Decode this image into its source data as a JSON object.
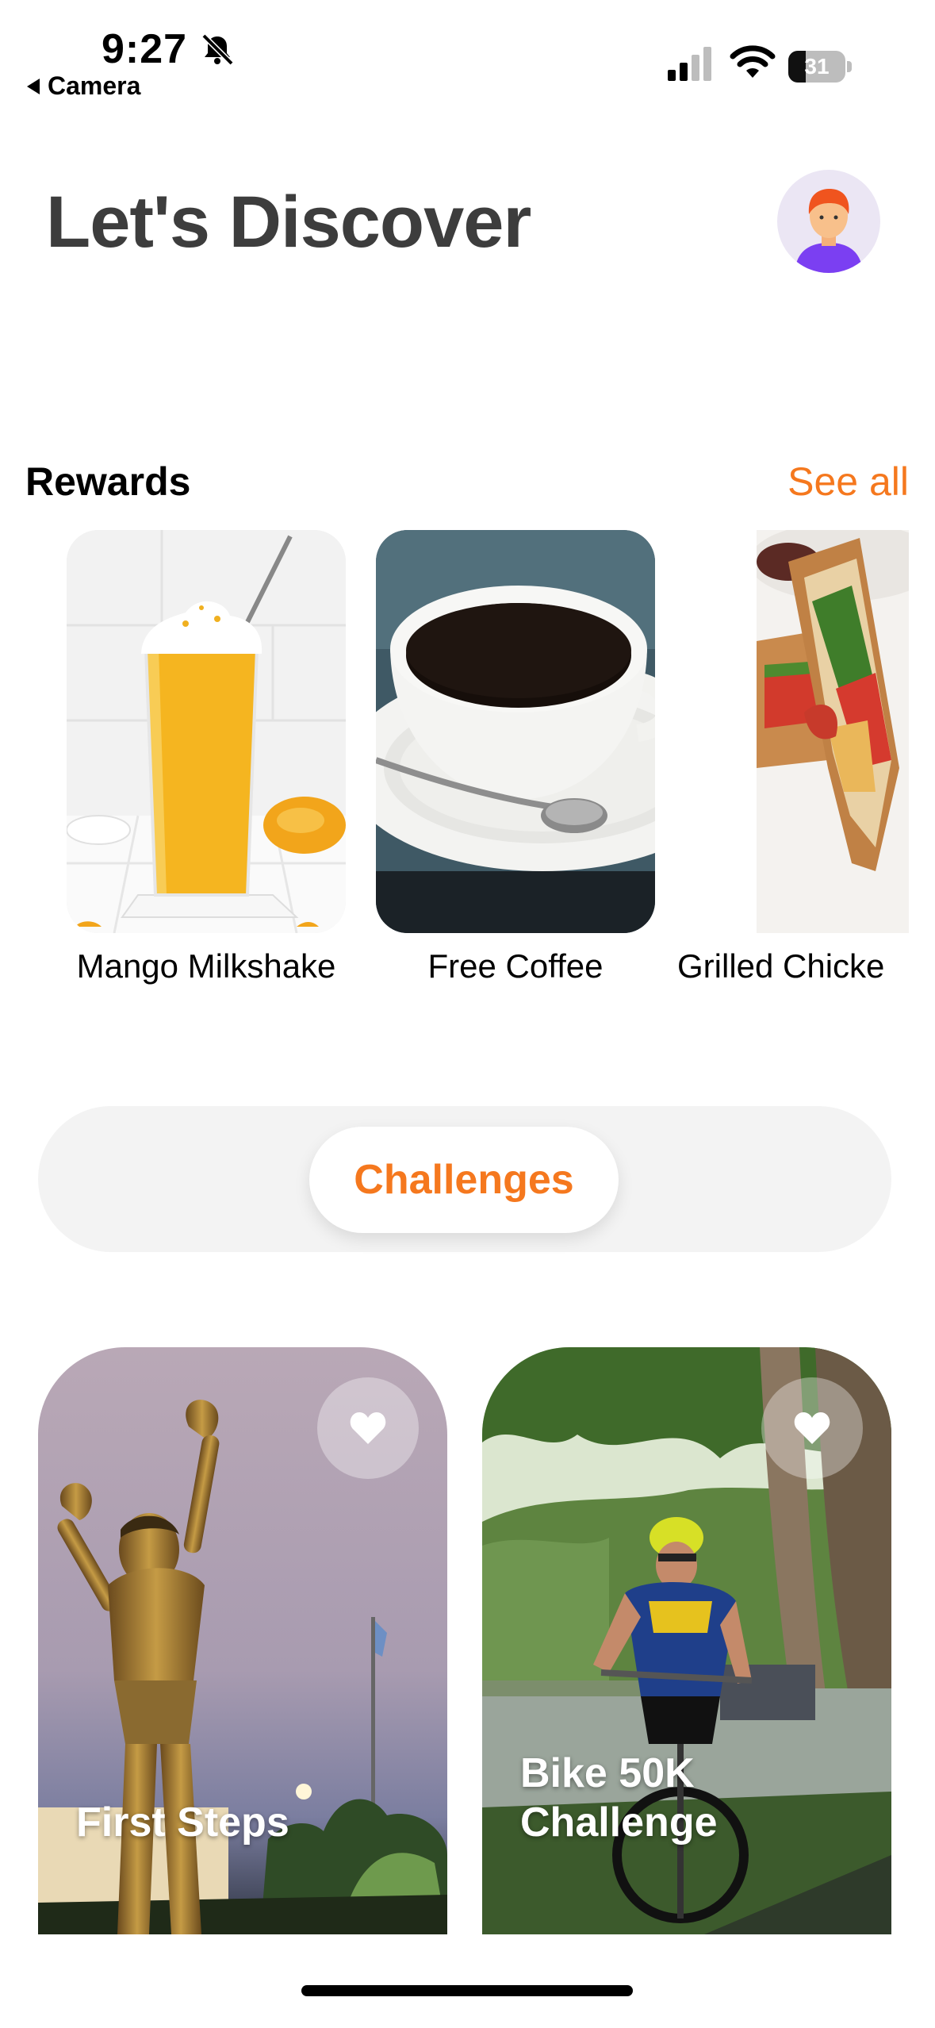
{
  "status_bar": {
    "time": "9:27",
    "back_label": "Camera",
    "battery": "31",
    "battery_level": 0.31
  },
  "header": {
    "title": "Let's Discover",
    "avatar_icon": "user-avatar-icon"
  },
  "rewards": {
    "title": "Rewards",
    "see_all": "See all",
    "items": [
      {
        "label": "Mango Milkshake",
        "image": "mango-milkshake-photo"
      },
      {
        "label": "Free Coffee",
        "image": "coffee-cup-photo"
      },
      {
        "label": "Grilled Chicke",
        "image": "grilled-chicken-sandwich-photo"
      }
    ]
  },
  "tabs": {
    "selected": "Challenges"
  },
  "challenges": [
    {
      "title": "First Steps",
      "image": "statue-photo",
      "icon": "heart-icon"
    },
    {
      "title": "Bike 50K Challenge",
      "image": "cyclist-photo",
      "icon": "heart-icon"
    }
  ],
  "colors": {
    "accent": "#f5781e",
    "title": "#3d3d3d",
    "segment_bg": "#f3f3f3"
  }
}
